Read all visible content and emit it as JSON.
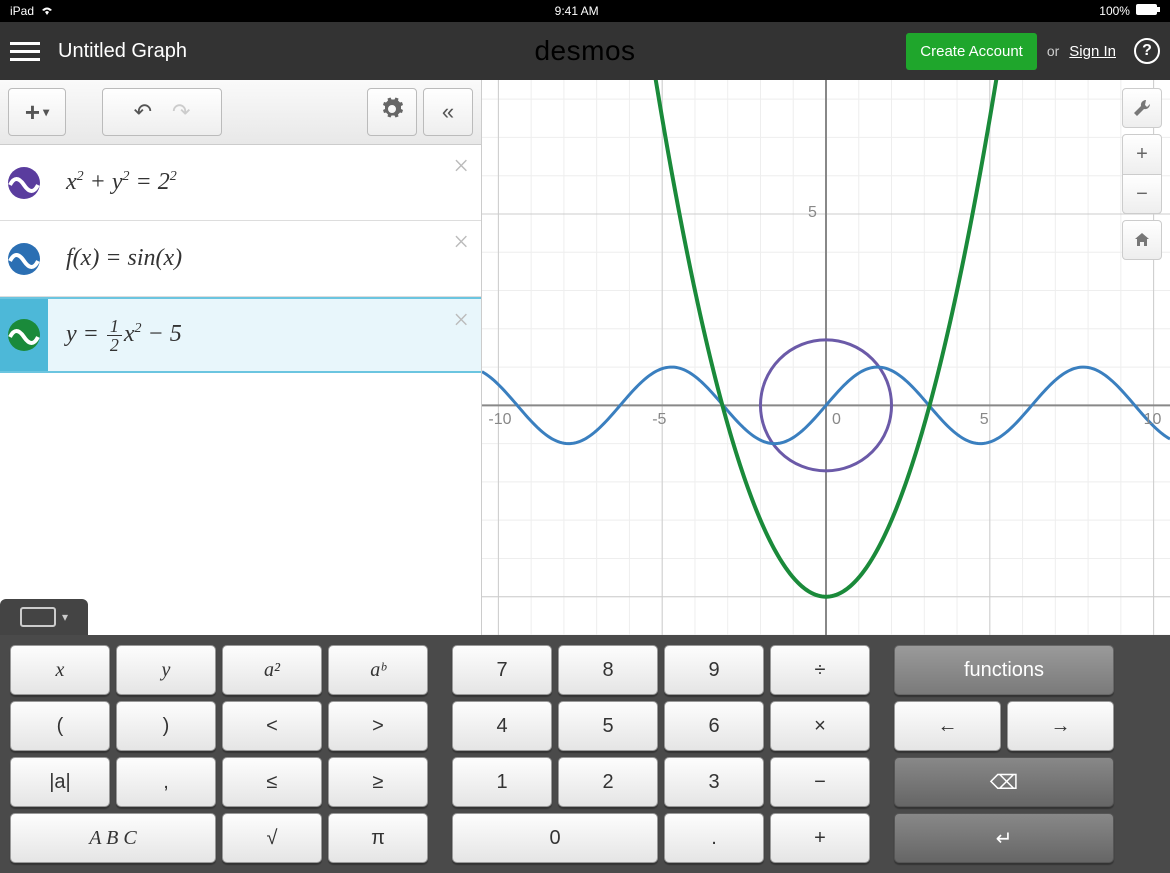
{
  "status": {
    "device": "iPad",
    "time": "9:41 AM",
    "battery": "100%"
  },
  "header": {
    "title": "Untitled Graph",
    "brand": "desmos",
    "create": "Create Account",
    "or": "or",
    "signin": "Sign In",
    "help": "?"
  },
  "toolbar": {
    "add": "+",
    "collapse": "«"
  },
  "expressions": [
    {
      "color": "#5a3c9e",
      "latex_parts": [
        "x",
        "2",
        " + y",
        "2",
        " = 2",
        "2"
      ],
      "selected": false
    },
    {
      "color": "#2b6fb3",
      "text": "f(x) = sin(x)",
      "selected": false
    },
    {
      "color": "#1a8a3a",
      "prefix": "y = ",
      "frac_num": "1",
      "frac_den": "2",
      "suffix1": "x",
      "sup": "2",
      "suffix2": " − 5",
      "selected": true
    }
  ],
  "graph": {
    "ticks_x": [
      {
        "v": -10,
        "label": "-10"
      },
      {
        "v": -5,
        "label": "-5"
      },
      {
        "v": 5,
        "label": "5"
      },
      {
        "v": 10,
        "label": "10"
      }
    ],
    "ticks_y": [
      {
        "v": 5,
        "label": "5"
      }
    ],
    "origin": "0",
    "controls": {
      "zoom_in": "+",
      "zoom_out": "−"
    }
  },
  "chart_data": {
    "type": "line",
    "xlim": [
      -10.5,
      10.5
    ],
    "ylim": [
      -6,
      8.5
    ],
    "series": [
      {
        "name": "circle",
        "equation": "x^2 + y^2 = 4",
        "color": "#6b5aa8"
      },
      {
        "name": "sin",
        "equation": "y = sin(x)",
        "color": "#3a7fbf"
      },
      {
        "name": "parabola",
        "equation": "y = 0.5*x^2 - 5",
        "color": "#1a8a3a"
      }
    ]
  },
  "keyboard": {
    "sec1": [
      "x",
      "y",
      "a²",
      "aᵇ",
      "(",
      ")",
      "<",
      ">",
      "|a|",
      ",",
      "≤",
      "≥",
      "A B C",
      "",
      "√",
      "π"
    ],
    "sec2": [
      "7",
      "8",
      "9",
      "÷",
      "4",
      "5",
      "6",
      "×",
      "1",
      "2",
      "3",
      "−",
      "0",
      "",
      ".",
      "+"
    ],
    "functions": "functions",
    "arrows": [
      "←",
      "→"
    ],
    "backspace": "⌫",
    "enter": "↵"
  }
}
